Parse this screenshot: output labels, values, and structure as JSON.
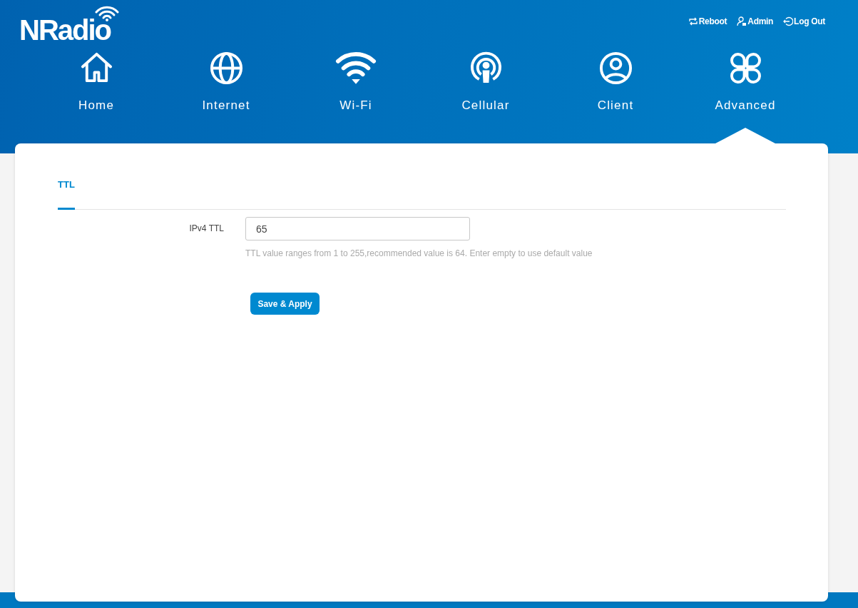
{
  "logo": {
    "text": "NRadio"
  },
  "top_links": [
    {
      "label": "Reboot"
    },
    {
      "label": "Admin"
    },
    {
      "label": "Log Out"
    }
  ],
  "nav": [
    {
      "label": "Home",
      "selected": false
    },
    {
      "label": "Internet",
      "selected": false
    },
    {
      "label": "Wi-Fi",
      "selected": false
    },
    {
      "label": "Cellular",
      "selected": false
    },
    {
      "label": "Client",
      "selected": false
    },
    {
      "label": "Advanced",
      "selected": true
    }
  ],
  "tabs": [
    {
      "label": "TTL",
      "selected": true
    }
  ],
  "form": {
    "label": "IPv4 TTL",
    "value": "65",
    "hint": "TTL value ranges from 1 to 255,recommended value is 64. Enter empty to use default value"
  },
  "button": "Save & Apply"
}
